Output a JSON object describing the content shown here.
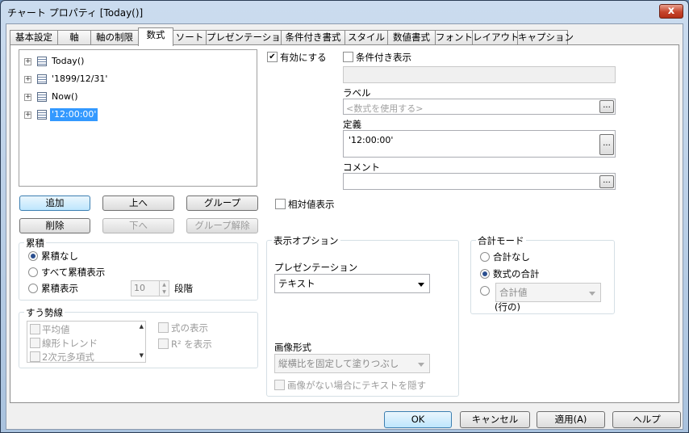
{
  "window": {
    "title": "チャート プロパティ [Today()]",
    "close_label": "x"
  },
  "tabs": [
    "基本設定",
    "軸",
    "軸の制限",
    "数式",
    "ソート",
    "プレゼンテーション",
    "条件付き書式",
    "スタイル",
    "数値書式",
    "フォント",
    "レイアウト",
    "キャプション"
  ],
  "active_tab": "数式",
  "tree": {
    "items": [
      "Today()",
      "'1899/12/31'",
      "Now()",
      "'12:00:00'"
    ],
    "selected": "'12:00:00'"
  },
  "buttons": {
    "add": "追加",
    "up": "上へ",
    "group": "グループ",
    "delete": "削除",
    "down": "下へ",
    "ungroup": "グループ解除"
  },
  "enable": {
    "label": "有効にする",
    "checked": true
  },
  "conditional": {
    "label": "条件付き表示",
    "checked": false
  },
  "label_field": {
    "label": "ラベル",
    "placeholder": "<数式を使用する>"
  },
  "definition": {
    "label": "定義",
    "value": "'12:00:00'"
  },
  "comment": {
    "label": "コメント",
    "value": ""
  },
  "relative": {
    "label": "相対値表示"
  },
  "accumulation": {
    "title": "累積",
    "options": [
      "累積なし",
      "すべて累積表示",
      "累積表示"
    ],
    "selected": 0,
    "steps_value": "10",
    "steps_label": "段階"
  },
  "trendlines": {
    "title": "すう勢線",
    "items": [
      "平均値",
      "線形トレンド",
      "2次元多項式"
    ],
    "show_formula": "式の表示",
    "show_r2": "R² を表示"
  },
  "display_options": {
    "title": "表示オプション",
    "presentation_label": "プレゼンテーション",
    "presentation_value": "テキスト",
    "image_format_label": "画像形式",
    "image_format_value": "縦横比を固定して塗りつぶし",
    "hide_text_label": "画像がない場合にテキストを隠す"
  },
  "total_mode": {
    "title": "合計モード",
    "options": [
      "合計なし",
      "数式の合計"
    ],
    "selected": 1,
    "combo_value": "合計値",
    "row_label": "(行の)"
  },
  "footer": {
    "ok": "OK",
    "cancel": "キャンセル",
    "apply": "適用(A)",
    "help": "ヘルプ"
  }
}
